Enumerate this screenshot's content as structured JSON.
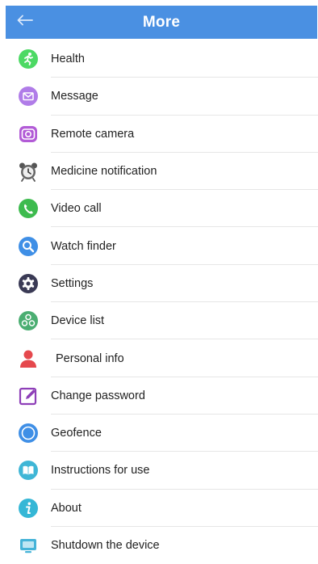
{
  "header": {
    "title": "More",
    "back_icon": "back-arrow-icon"
  },
  "colors": {
    "header_bg": "#4A90E2"
  },
  "items": [
    {
      "label": "Health",
      "icon": "health-run-icon",
      "color": "#4CD964"
    },
    {
      "label": "Message",
      "icon": "envelope-icon",
      "color": "#B07CE8"
    },
    {
      "label": "Remote camera",
      "icon": "camera-icon",
      "color": "#B25BD6"
    },
    {
      "label": "Medicine notification",
      "icon": "alarm-clock-icon",
      "color": "#555555"
    },
    {
      "label": "Video call",
      "icon": "phone-icon",
      "color": "#3DBB4E"
    },
    {
      "label": "Watch finder",
      "icon": "magnifier-icon",
      "color": "#3F8FE6"
    },
    {
      "label": "Settings",
      "icon": "gear-icon",
      "color": "#3A3A55"
    },
    {
      "label": "Device list",
      "icon": "devices-icon",
      "color": "#4BAE72"
    },
    {
      "label": "Personal info",
      "icon": "person-icon",
      "color": "#E5484D"
    },
    {
      "label": "Change password",
      "icon": "edit-icon",
      "color": "#8E3FB8"
    },
    {
      "label": "Geofence",
      "icon": "circle-fence-icon",
      "color": "#3F8FE6"
    },
    {
      "label": "Instructions for use",
      "icon": "book-icon",
      "color": "#3FB6D6"
    },
    {
      "label": "About",
      "icon": "info-icon",
      "color": "#35B7D6"
    },
    {
      "label": "Shutdown the device",
      "icon": "screen-power-icon",
      "color": "#45B3D8"
    }
  ]
}
